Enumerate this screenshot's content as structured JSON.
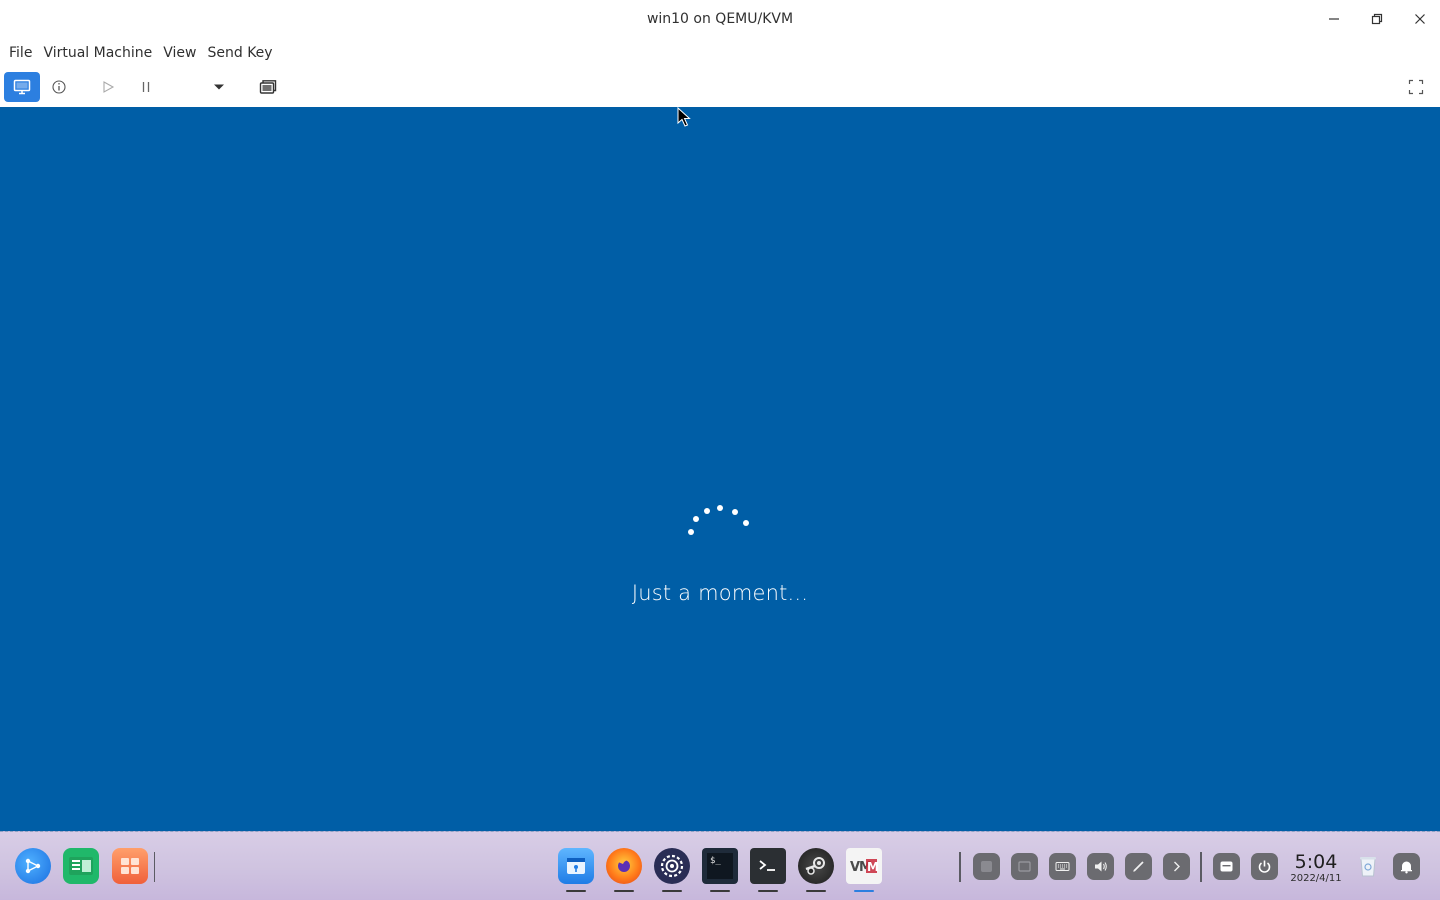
{
  "window": {
    "title": "win10 on QEMU/KVM"
  },
  "menubar": {
    "items": [
      "File",
      "Virtual Machine",
      "View",
      "Send Key"
    ]
  },
  "toolbar": {
    "buttons": [
      "console-icon",
      "info-icon",
      "play-icon",
      "pause-icon",
      "dropdown-icon",
      "snapshot-icon",
      "fullscreen-icon"
    ]
  },
  "vm": {
    "status_text": "Just a moment...",
    "background_color": "#005ea6"
  },
  "taskbar": {
    "clock_time": "5:04",
    "clock_date": "2022/4/11",
    "apps_left": [
      "launcher-icon",
      "file-manager-icon",
      "app-store-icon"
    ],
    "apps_center": [
      "app-installer-icon",
      "firefox-icon",
      "settings-icon",
      "terminal-icon",
      "terminal2-icon",
      "steam-icon",
      "vim-icon"
    ],
    "tray": [
      "tray-app-1-icon",
      "tray-app-2-icon",
      "keyboard-icon",
      "volume-icon",
      "pen-icon",
      "chevron-right-icon",
      "input-method-icon",
      "power-icon",
      "trash-icon",
      "notification-icon"
    ]
  },
  "colors": {
    "accent": "#2c7fe0",
    "vm_background": "#005ea6"
  }
}
